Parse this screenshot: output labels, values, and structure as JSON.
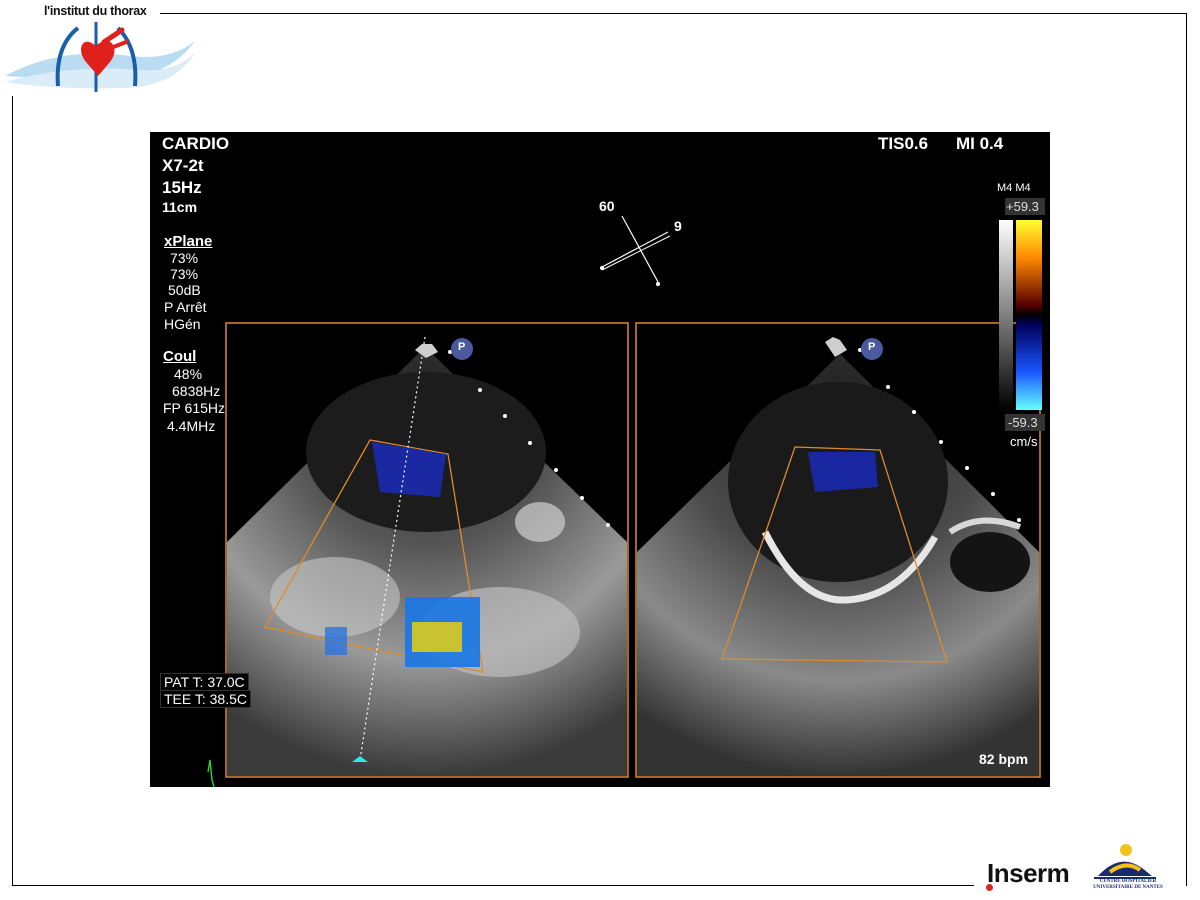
{
  "header": {
    "institution": "l'institut du thorax"
  },
  "ultrasound": {
    "mode": "CARDIO",
    "probe": "X7-2t",
    "frame_rate": "15Hz",
    "depth": "11cm",
    "tis": "TIS0.6",
    "mi": "MI 0.4",
    "xplane": {
      "title": "xPlane",
      "values": [
        "73%",
        "73%",
        "50dB",
        "P Arrêt",
        "HGén"
      ]
    },
    "color": {
      "title": "Coul",
      "values": [
        "48%",
        "6838Hz",
        "FP 615Hz",
        "4.4MHz"
      ]
    },
    "angles": {
      "primary": "60",
      "secondary": "9"
    },
    "scale": {
      "label": "M4 M4",
      "max": "+59.3",
      "min": "-59.3",
      "unit": "cm/s"
    },
    "marker": "P",
    "pat_temp": "PAT T: 37.0C",
    "tee_temp": "TEE T: 38.5C",
    "heart_rate": "82 bpm"
  },
  "footer": {
    "inserm": "Inserm",
    "chu": "CENTRE HOSPITALIER UNIVERSITAIRE DE NANTES"
  }
}
